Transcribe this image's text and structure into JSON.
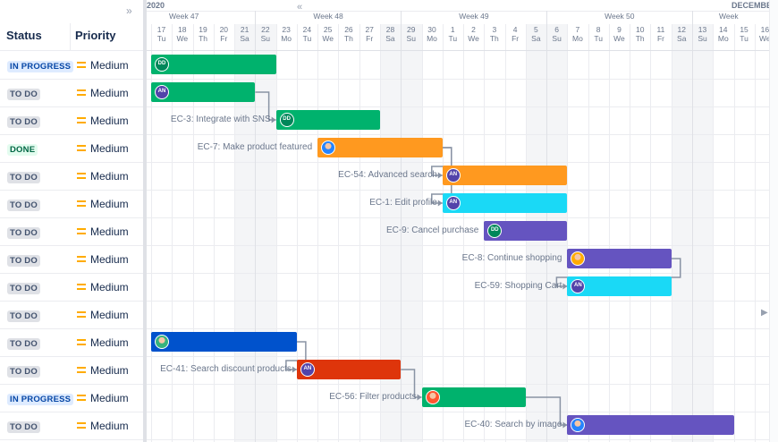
{
  "columns": {
    "status": "Status",
    "priority": "Priority"
  },
  "timeline": {
    "years": [
      "2020",
      "DECEMBE"
    ],
    "weeks": [
      "Week 47",
      "Week 48",
      "Week 49",
      "Week 50",
      "Week"
    ],
    "days": [
      {
        "n": "17",
        "d": "Tu"
      },
      {
        "n": "18",
        "d": "We"
      },
      {
        "n": "19",
        "d": "Th"
      },
      {
        "n": "20",
        "d": "Fr"
      },
      {
        "n": "21",
        "d": "Sa"
      },
      {
        "n": "22",
        "d": "Su"
      },
      {
        "n": "23",
        "d": "Mo"
      },
      {
        "n": "24",
        "d": "Tu"
      },
      {
        "n": "25",
        "d": "We"
      },
      {
        "n": "26",
        "d": "Th"
      },
      {
        "n": "27",
        "d": "Fr"
      },
      {
        "n": "28",
        "d": "Sa"
      },
      {
        "n": "29",
        "d": "Su"
      },
      {
        "n": "30",
        "d": "Mo"
      },
      {
        "n": "1",
        "d": "Tu"
      },
      {
        "n": "2",
        "d": "We"
      },
      {
        "n": "3",
        "d": "Th"
      },
      {
        "n": "4",
        "d": "Fr"
      },
      {
        "n": "5",
        "d": "Sa"
      },
      {
        "n": "6",
        "d": "Su"
      },
      {
        "n": "7",
        "d": "Mo"
      },
      {
        "n": "8",
        "d": "Tu"
      },
      {
        "n": "9",
        "d": "We"
      },
      {
        "n": "10",
        "d": "Th"
      },
      {
        "n": "11",
        "d": "Fr"
      },
      {
        "n": "12",
        "d": "Sa"
      },
      {
        "n": "13",
        "d": "Su"
      },
      {
        "n": "14",
        "d": "Mo"
      },
      {
        "n": "15",
        "d": "Tu"
      },
      {
        "n": "16",
        "d": "We"
      }
    ]
  },
  "rows": [
    {
      "status": "IN PROGRESS",
      "priority": "Medium",
      "label": "",
      "start": 0,
      "end": 6,
      "color": "#00b26d",
      "av": "DD",
      "avcolor": "#00875a"
    },
    {
      "status": "TO DO",
      "priority": "Medium",
      "label": "",
      "start": 0,
      "end": 5,
      "color": "#00b26d",
      "av": "AN",
      "avcolor": "#5243aa"
    },
    {
      "status": "TO DO",
      "priority": "Medium",
      "label": "EC-3: Integrate with SNS",
      "start": 6,
      "end": 11,
      "color": "#00b26d",
      "av": "DD",
      "avcolor": "#00875a"
    },
    {
      "status": "DONE",
      "priority": "Medium",
      "label": "EC-7: Make product featured",
      "start": 8,
      "end": 14,
      "color": "#ff991f",
      "av": "photo",
      "avcolor": "#2684ff"
    },
    {
      "status": "TO DO",
      "priority": "Medium",
      "label": "EC-54: Advanced search",
      "start": 14,
      "end": 20,
      "color": "#ff991f",
      "av": "AN",
      "avcolor": "#5243aa"
    },
    {
      "status": "TO DO",
      "priority": "Medium",
      "label": "EC-1: Edit profile",
      "start": 14,
      "end": 20,
      "color": "#1ad9f6",
      "av": "AN",
      "avcolor": "#5243aa"
    },
    {
      "status": "TO DO",
      "priority": "Medium",
      "label": "EC-9: Cancel purchase",
      "start": 16,
      "end": 20,
      "color": "#6554c0",
      "av": "DD",
      "avcolor": "#00875a"
    },
    {
      "status": "TO DO",
      "priority": "Medium",
      "label": "EC-8: Continue shopping",
      "start": 20,
      "end": 25,
      "color": "#6554c0",
      "av": "photo",
      "avcolor": "#ffab00"
    },
    {
      "status": "TO DO",
      "priority": "Medium",
      "label": "EC-59: Shopping Cart",
      "start": 20,
      "end": 25,
      "color": "#1ad9f6",
      "av": "AN",
      "avcolor": "#5243aa"
    },
    {
      "status": "TO DO",
      "priority": "Medium",
      "label": "",
      "start": null,
      "end": null,
      "color": "",
      "av": "",
      "avcolor": ""
    },
    {
      "status": "TO DO",
      "priority": "Medium",
      "label": "",
      "start": 0,
      "end": 7,
      "color": "#0052cc",
      "av": "photo",
      "avcolor": "#36b37e"
    },
    {
      "status": "TO DO",
      "priority": "Medium",
      "label": "EC-41: Search discount products",
      "start": 7,
      "end": 12,
      "color": "#de350b",
      "av": "AN",
      "avcolor": "#5243aa"
    },
    {
      "status": "IN PROGRESS",
      "priority": "Medium",
      "label": "EC-56: Filter products",
      "start": 13,
      "end": 18,
      "color": "#00b26d",
      "av": "photo",
      "avcolor": "#ff5630"
    },
    {
      "status": "TO DO",
      "priority": "Medium",
      "label": "EC-40: Search by image",
      "start": 20,
      "end": 28,
      "color": "#6554c0",
      "av": "photo",
      "avcolor": "#2684ff"
    }
  ],
  "dependencies": [
    [
      1,
      2
    ],
    [
      3,
      4
    ],
    [
      3,
      5
    ],
    [
      7,
      8
    ],
    [
      10,
      11
    ],
    [
      11,
      12
    ],
    [
      12,
      13
    ]
  ],
  "icons": {
    "collapse": "double-chevron-right-icon",
    "expand": "double-chevron-left-icon",
    "scroll": "triangle-right-icon"
  }
}
